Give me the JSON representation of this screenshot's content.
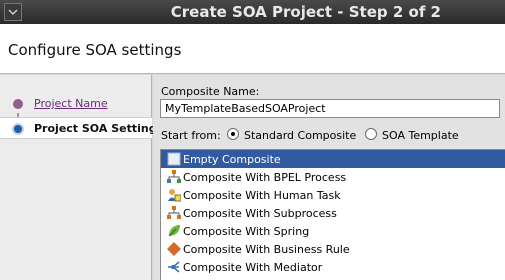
{
  "window": {
    "title": "Create SOA Project - Step 2 of 2"
  },
  "header": {
    "title": "Configure SOA settings"
  },
  "nav": {
    "items": [
      {
        "label": "Project Name",
        "state": "visited"
      },
      {
        "label": "Project SOA Settings",
        "state": "current"
      }
    ]
  },
  "form": {
    "composite_name_label": "Composite Name:",
    "composite_name_value": "MyTemplateBasedSOAProject",
    "start_from_label": "Start from:",
    "start_options": [
      {
        "label": "Standard Composite",
        "selected": true
      },
      {
        "label": "SOA Template",
        "selected": false
      }
    ]
  },
  "templates": {
    "items": [
      {
        "label": "Empty Composite",
        "icon": "empty-composite-icon",
        "selected": true
      },
      {
        "label": "Composite With BPEL Process",
        "icon": "bpel-process-icon",
        "selected": false
      },
      {
        "label": "Composite With Human Task",
        "icon": "human-task-icon",
        "selected": false
      },
      {
        "label": "Composite With Subprocess",
        "icon": "subprocess-icon",
        "selected": false
      },
      {
        "label": "Composite With Spring",
        "icon": "spring-icon",
        "selected": false
      },
      {
        "label": "Composite With Business Rule",
        "icon": "business-rule-icon",
        "selected": false
      },
      {
        "label": "Composite With Mediator",
        "icon": "mediator-icon",
        "selected": false
      }
    ]
  },
  "colors": {
    "titlebar": "#2f2f2f",
    "selection": "#315aa0",
    "visited_link": "#6b2a7a",
    "current_step": "#1e5ea8"
  }
}
